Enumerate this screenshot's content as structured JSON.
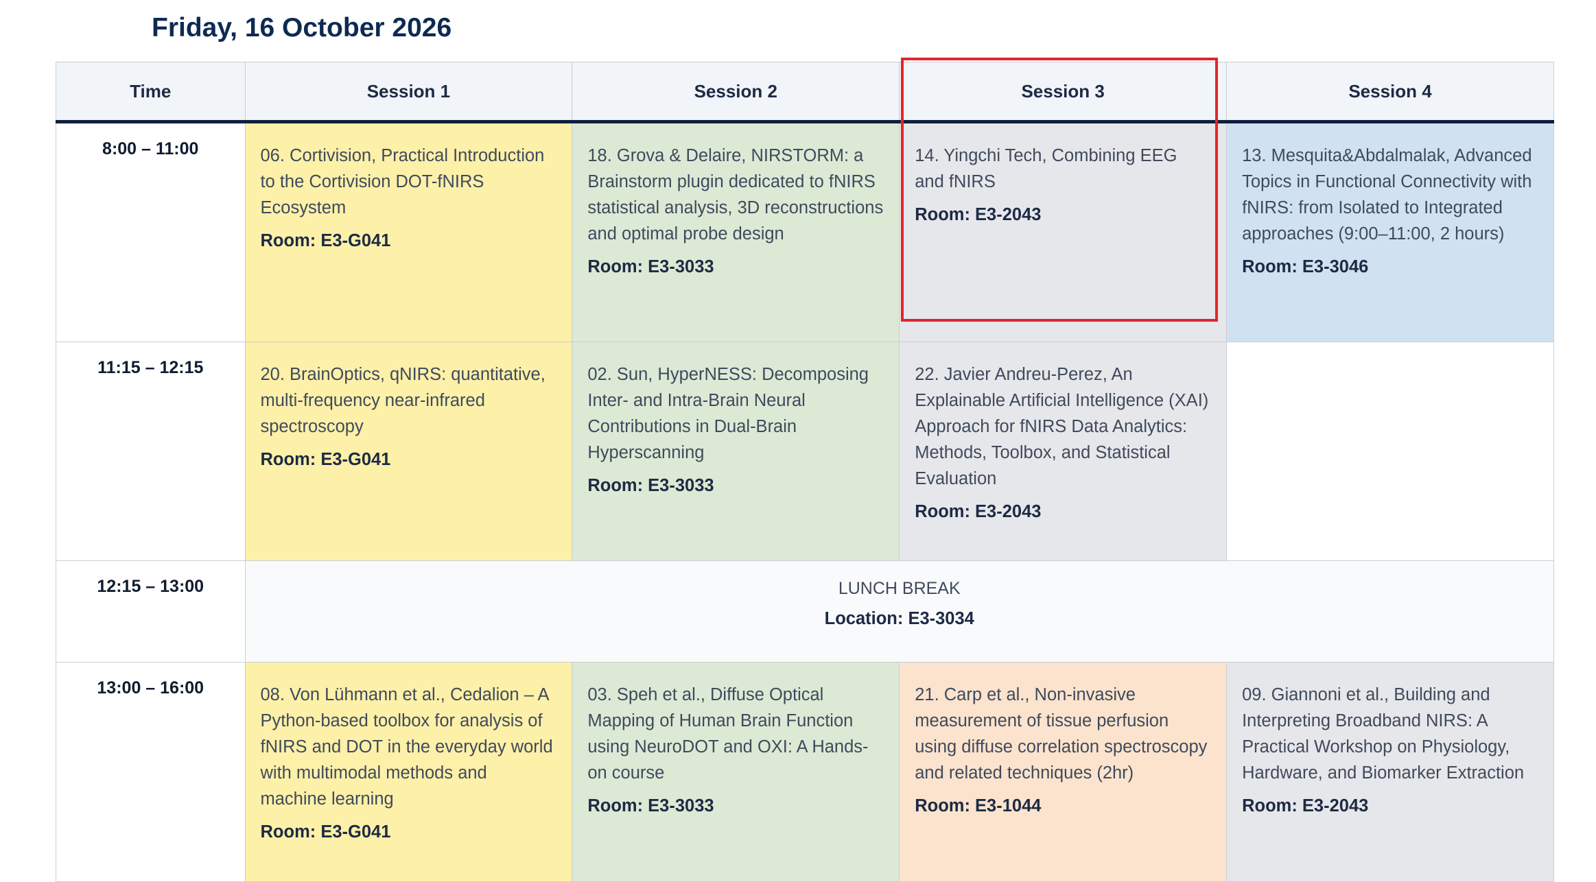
{
  "page": {
    "title": "Friday, 16 October 2026"
  },
  "columns": [
    "Time",
    "Session 1",
    "Session 2",
    "Session 3",
    "Session 4"
  ],
  "rows": [
    {
      "time": "8:00 – 11:00",
      "sessions": [
        {
          "title": "06. Cortivision, Practical Introduction to the Cortivision DOT-fNIRS Ecosystem",
          "room": "Room: E3-G041",
          "color": "#fdf0a8"
        },
        {
          "title": "18. Grova & Delaire, NIRSTORM: a Brainstorm plugin dedicated to fNIRS statistical analysis, 3D reconstructions and optimal probe design",
          "room": "Room: E3-3033",
          "color": "#dce9d5"
        },
        {
          "title": "14. Yingchi Tech, Combining EEG and fNIRS",
          "room": "Room: E3-2043",
          "color": "#e6e7ea"
        },
        {
          "title": "13. Mesquita&Abdalmalak, Advanced Topics in Functional Connectivity with fNIRS: from Isolated to Integrated approaches (9:00–11:00, 2 hours)",
          "room": "Room: E3-3046",
          "color": "#d0e2f2"
        }
      ]
    },
    {
      "time": "11:15 – 12:15",
      "sessions": [
        {
          "title": "20. BrainOptics, qNIRS: quantitative, multi-frequency near-infrared spectroscopy",
          "room": "Room: E3-G041",
          "color": "#fdf0a8"
        },
        {
          "title": "02. Sun, HyperNESS: Decomposing Inter- and Intra-Brain Neural Contributions in Dual-Brain Hyperscanning",
          "room": "Room: E3-3033",
          "color": "#dce9d5"
        },
        {
          "title": "22. Javier Andreu-Perez, An Explainable Artificial Intelligence (XAI) Approach for fNIRS Data Analytics: Methods, Toolbox, and Statistical Evaluation",
          "room": "Room: E3-2043",
          "color": "#e6e7ea"
        }
      ]
    },
    {
      "time": "12:15 – 13:00",
      "lunch": {
        "title": "LUNCH BREAK",
        "location": "Location: E3-3034"
      }
    },
    {
      "time": "13:00 – 16:00",
      "sessions": [
        {
          "title": "08. Von Lühmann et al., Cedalion – A Python-based toolbox for analysis of fNIRS and DOT in the everyday world with multimodal methods and machine learning",
          "room": "Room: E3-G041",
          "color": "#fdf0a8"
        },
        {
          "title": "03. Speh et al., Diffuse Optical Mapping of Human Brain Function using NeuroDOT and OXI: A Hands-on course",
          "room": "Room: E3-3033",
          "color": "#dce9d5"
        },
        {
          "title": "21. Carp et al., Non-invasive measurement of tissue perfusion using diffuse correlation spectroscopy and related techniques (2hr)",
          "room": "Room: E3-1044",
          "color": "#fbe3cd"
        },
        {
          "title": "09. Giannoni et al., Building and Interpreting Broadband NIRS: A Practical Workshop on Physiology, Hardware, and Biomarker Extraction",
          "room": "Room: E3-2043",
          "color": "#e6e7ea"
        }
      ]
    }
  ],
  "highlight": {
    "color": "#e0262c",
    "target": "Session 3"
  }
}
